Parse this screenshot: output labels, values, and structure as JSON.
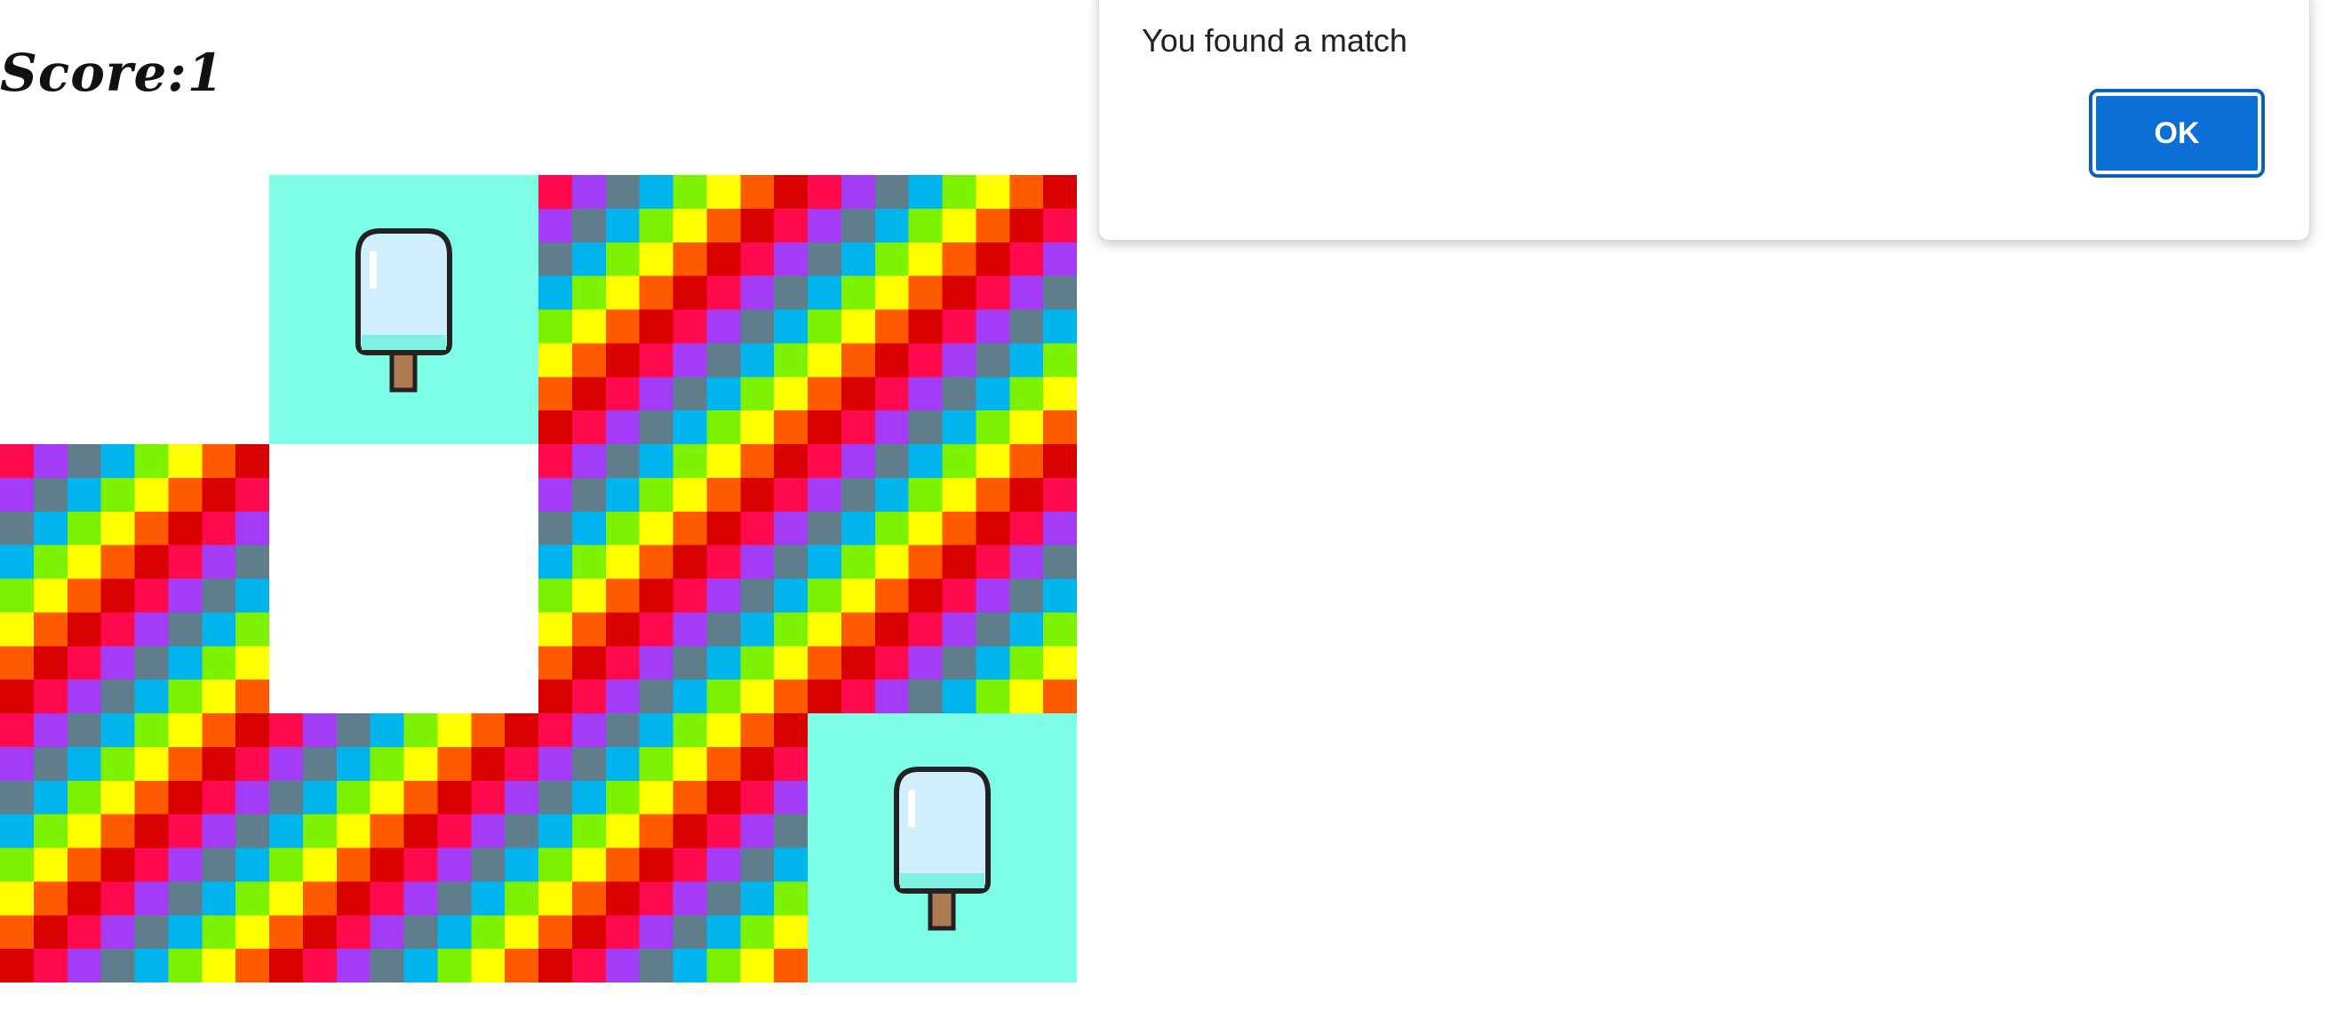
{
  "score": {
    "label": "Score:",
    "value": "1"
  },
  "board": {
    "rows": 3,
    "cols": 4,
    "cells": [
      {
        "state": "matched"
      },
      {
        "state": "revealed",
        "item": "popsicle"
      },
      {
        "state": "hidden"
      },
      {
        "state": "hidden"
      },
      {
        "state": "hidden"
      },
      {
        "state": "matched"
      },
      {
        "state": "hidden"
      },
      {
        "state": "hidden"
      },
      {
        "state": "hidden"
      },
      {
        "state": "hidden"
      },
      {
        "state": "hidden"
      },
      {
        "state": "revealed",
        "item": "popsicle"
      }
    ],
    "face_color": "#7dfde6",
    "back_palette": [
      "#ff0a4e",
      "#a33cf6",
      "#5f7d8a",
      "#00b4ee",
      "#7cf200",
      "#ffff00",
      "#ff5a00",
      "#d90000"
    ]
  },
  "dialog": {
    "message": "You found a match",
    "ok_label": "OK"
  },
  "colors": {
    "accent": "#0b6fd8"
  }
}
